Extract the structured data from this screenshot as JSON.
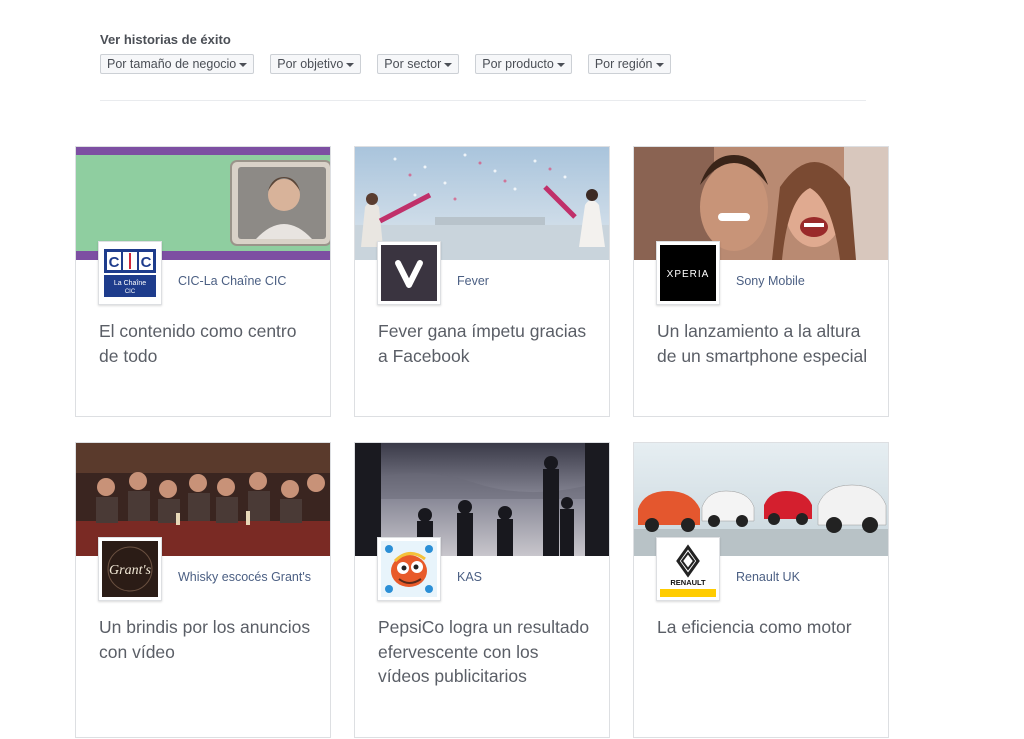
{
  "filters": {
    "title": "Ver historias de éxito",
    "buttons": [
      {
        "label": "Por tamaño de negocio"
      },
      {
        "label": "Por objetivo"
      },
      {
        "label": "Por sector"
      },
      {
        "label": "Por producto"
      },
      {
        "label": "Por región"
      }
    ]
  },
  "cards": [
    {
      "brand": "CIC-La Chaîne CIC",
      "headline": "El contenido como centro de todo",
      "logo_text": "La Chaîne CIC",
      "logo_mark": "CIC",
      "colors": {
        "accent": "#7a4aa0",
        "bg": "#8ccc9a"
      }
    },
    {
      "brand": "Fever",
      "headline": "Fever gana ímpetu gracias a Facebook",
      "logo_mark": "V",
      "colors": {
        "bg": "#3a3440"
      }
    },
    {
      "brand": "Sony Mobile",
      "headline": "Un lanzamiento a la altura de un smartphone especial",
      "logo_mark": "XPERIA",
      "colors": {
        "bg": "#000000"
      }
    },
    {
      "brand": "Whisky escocés Grant's",
      "headline": "Un brindis por los anuncios con vídeo",
      "logo_mark": "Grant's",
      "colors": {
        "bg": "#2a1a14"
      }
    },
    {
      "brand": "KAS",
      "headline": "PepsiCo logra un resultado efervescente con los vídeos publicitarios",
      "logo_mark": "KAS",
      "colors": {
        "bg": "#2b8fd6"
      }
    },
    {
      "brand": "Renault UK",
      "headline": "La eficiencia como motor",
      "logo_mark": "RENAULT",
      "colors": {
        "bg": "#ffcc00"
      }
    }
  ]
}
